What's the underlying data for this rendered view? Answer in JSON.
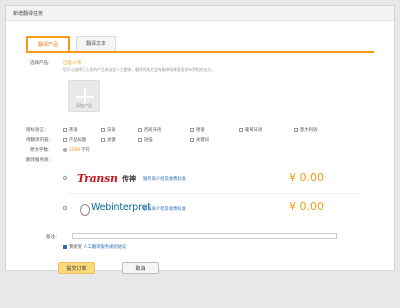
{
  "window_title": "新增翻译任务",
  "tabs": [
    {
      "label": "翻译产品",
      "active": true
    },
    {
      "label": "翻译文本",
      "active": false
    }
  ],
  "product": {
    "label": "选择产品：",
    "selected_text": "已选 0 项",
    "hint": "您可以选择已上架的产品来选定人工翻译，翻译完成后会有翻译结果直接发布到相应站点。",
    "add_label": "添加产品"
  },
  "target_language": {
    "label": "目标语言：",
    "options": [
      "英语",
      "法语",
      "西班牙语",
      "德语",
      "葡萄牙语",
      "意大利语"
    ]
  },
  "content": {
    "label": "待翻译内容：",
    "options": [
      "产品标题",
      "关键",
      "短描",
      "关键词"
    ]
  },
  "word_count": {
    "label": "原文字数：",
    "value": "1589",
    "unit": "字符"
  },
  "vendor": {
    "label": "翻译服务商：",
    "items": [
      {
        "logo": "Transn",
        "logo_cn": "传神",
        "link": "服务商介绍及收费标准",
        "price": "¥ 0.00"
      },
      {
        "logo": "Webinterpret",
        "link": "服务商介绍及收费标准",
        "price": "¥ 0.00"
      }
    ]
  },
  "note": {
    "label": "备注：",
    "value": "",
    "placeholder": ""
  },
  "agreement": {
    "prefix": "我接受",
    "link": "人工翻译服务规则协议"
  },
  "buttons": {
    "submit": "提交订单",
    "cancel": "取消"
  }
}
